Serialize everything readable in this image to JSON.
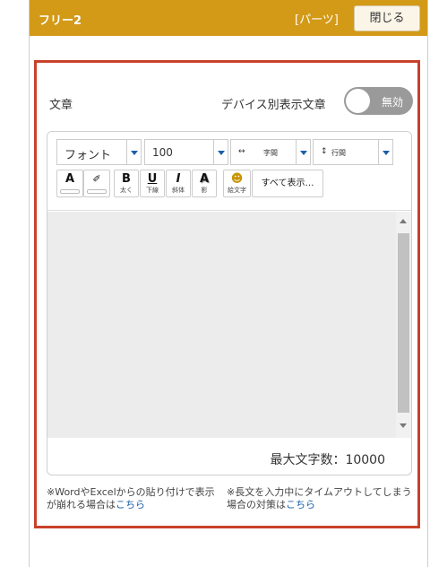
{
  "header": {
    "title": "フリー2",
    "parts_label": "[パーツ]",
    "close_label": "閉じる"
  },
  "field": {
    "label": "文章",
    "device_label": "デバイス別表示文章",
    "toggle_state": "無効"
  },
  "toolbar": {
    "font_select": "フォント",
    "size_select": "100",
    "letter_spacing": "字間",
    "line_spacing": "行間",
    "buttons": [
      {
        "glyph": "A",
        "sub": ""
      },
      {
        "glyph": "✐",
        "sub": ""
      },
      {
        "glyph": "B",
        "sub": "太く"
      },
      {
        "glyph": "U",
        "sub": "下線"
      },
      {
        "glyph": "I",
        "sub": "斜体"
      },
      {
        "glyph": "A",
        "sub": "影"
      },
      {
        "glyph": "☻",
        "sub": "絵文字"
      }
    ],
    "show_all": "すべて表示…"
  },
  "editor": {
    "max_chars": "最大文字数：10000"
  },
  "notes": [
    {
      "text": "※WordやExcelからの貼り付けで表示が崩れる場合は",
      "link": "こちら"
    },
    {
      "text": "※長文を入力中にタイムアウトしてしまう場合の対策は",
      "link": "こちら"
    }
  ]
}
